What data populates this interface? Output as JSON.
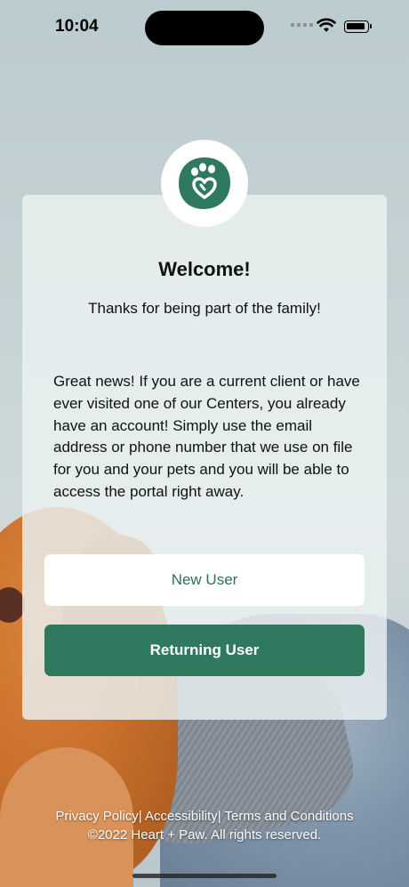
{
  "status": {
    "time": "10:04"
  },
  "card": {
    "title": "Welcome!",
    "tagline": "Thanks for being part of the family!",
    "body": "Great news! If you are a current client or have ever visited one of our Centers, you already have an account! Simply use the email address or phone number that we use on file for you and your pets and you will be able to access the portal right away."
  },
  "buttons": {
    "new_user": "New User",
    "returning_user": "Returning User"
  },
  "footer": {
    "links": "Privacy Policy| Accessibility| Terms and Conditions",
    "copyright": "©2022 Heart + Paw. All rights reserved."
  },
  "colors": {
    "brand_green": "#2f7a5f",
    "brand_text_green": "#2f6f5b"
  },
  "icons": [
    "heart-paw-logo-icon",
    "wifi-icon",
    "battery-icon",
    "signal-icon"
  ]
}
